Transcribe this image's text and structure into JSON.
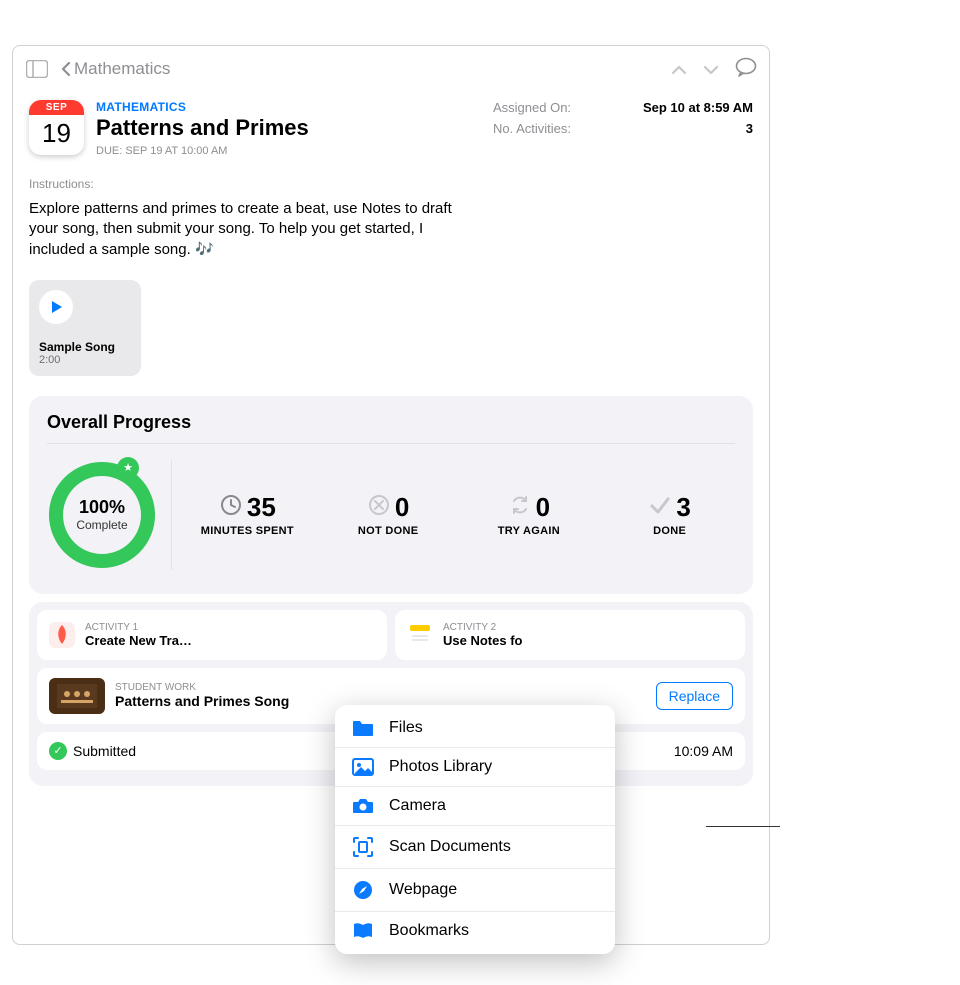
{
  "nav": {
    "back_label": "Mathematics"
  },
  "header": {
    "subject": "MATHEMATICS",
    "title": "Patterns and Primes",
    "due_line": "DUE: SEP 19 AT 10:00 AM",
    "cal_month": "SEP",
    "cal_day": "19",
    "meta": {
      "assigned_label": "Assigned On:",
      "assigned_value": "Sep 10 at 8:59 AM",
      "activities_label": "No. Activities:",
      "activities_value": "3"
    }
  },
  "instructions": {
    "label": "Instructions:",
    "text": "Explore patterns and primes to create a beat, use Notes to draft your song, then submit your song. To help you get started, I included a sample song. 🎶"
  },
  "media": {
    "title": "Sample Song",
    "duration": "2:00"
  },
  "progress": {
    "title": "Overall Progress",
    "percent_label": "100%",
    "complete_label": "Complete",
    "stats": {
      "minutes": {
        "value": "35",
        "label": "MINUTES SPENT"
      },
      "notdone": {
        "value": "0",
        "label": "NOT DONE"
      },
      "tryagain": {
        "value": "0",
        "label": "TRY AGAIN"
      },
      "done": {
        "value": "3",
        "label": "DONE"
      }
    }
  },
  "activities": {
    "a1": {
      "tag": "ACTIVITY 1",
      "name": "Create New Tra…"
    },
    "a2": {
      "tag": "ACTIVITY 2",
      "name": "Use Notes fo"
    }
  },
  "student_work": {
    "tag": "STUDENT WORK",
    "name": "Patterns and Primes Song",
    "replace_label": "Replace",
    "submitted_label": "Submitted",
    "submitted_time": "10:09 AM"
  },
  "menu": {
    "files": "Files",
    "photos": "Photos Library",
    "camera": "Camera",
    "scan": "Scan Documents",
    "webpage": "Webpage",
    "bookmarks": "Bookmarks"
  }
}
